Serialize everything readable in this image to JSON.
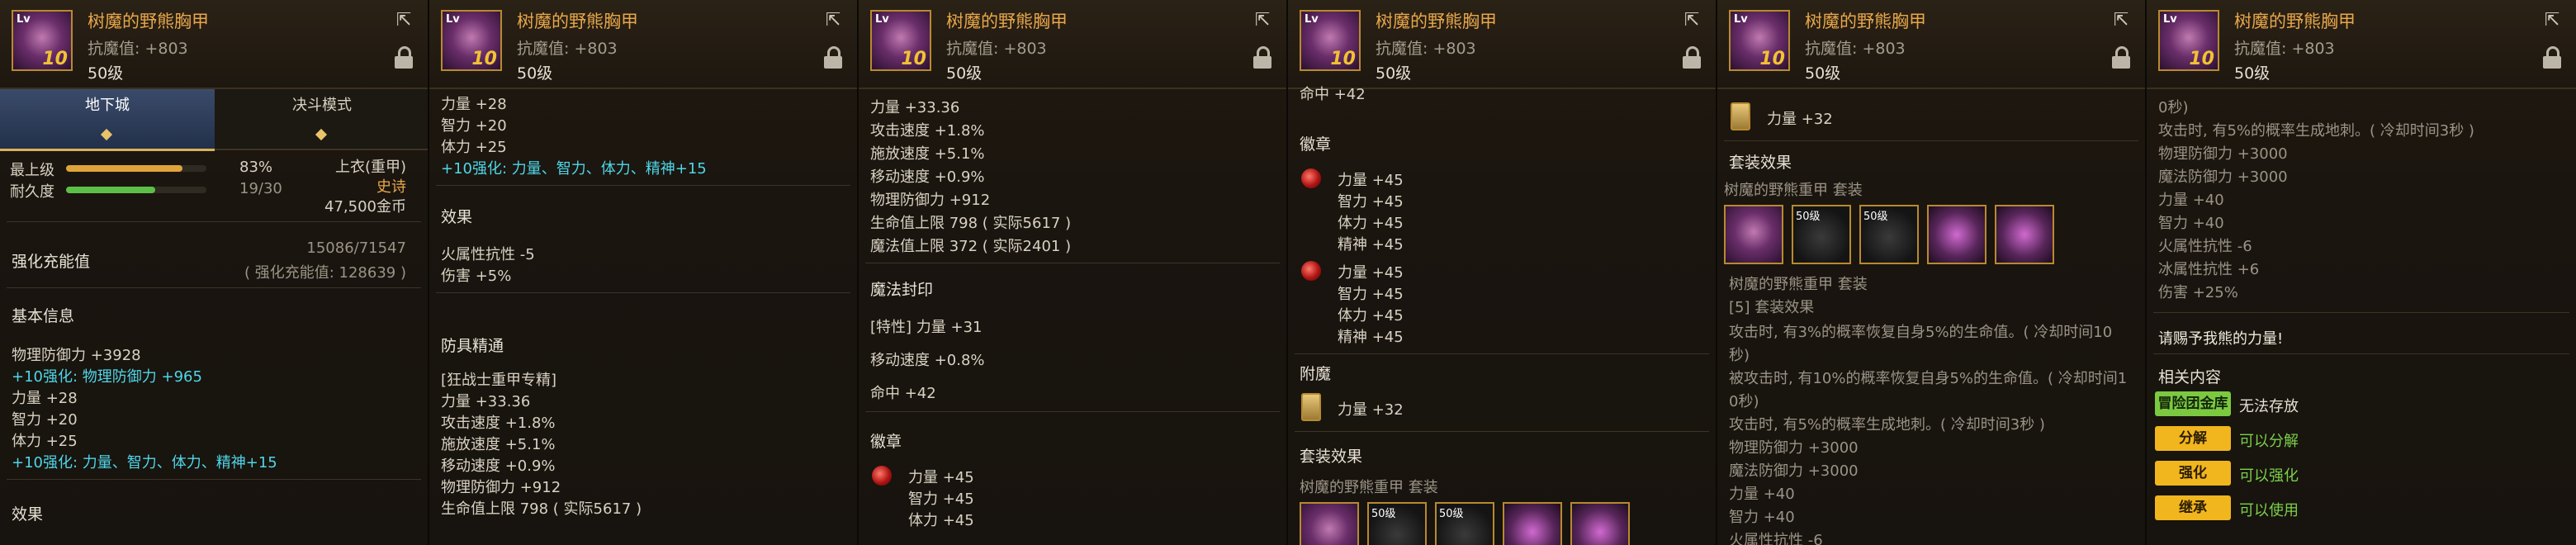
{
  "header": {
    "title": "树魔的野熊胸甲",
    "resist": "抗魔值: +803",
    "level": "50级",
    "icon_tier": "10",
    "icon_level": "Lv"
  },
  "p1": {
    "tabs": [
      "地下城",
      "决斗模式"
    ],
    "top_level_label": "最上级",
    "top_level_pct": "83%",
    "durability_label": "耐久度",
    "durability": "19/30",
    "top_level_fill": 0.83,
    "durability_fill": 0.633,
    "slot": "上衣(重甲)",
    "rarity": "史诗",
    "price": "47,500金币",
    "enh_label": "强化充能值",
    "enh_value": "15086/71547",
    "enh_sub": "( 强化充能值: 128639 )",
    "basic_title": "基本信息",
    "lines": [
      "物理防御力 +3928",
      "+10强化: 物理防御力 +965",
      "力量 +28",
      "智力 +20",
      "体力 +25",
      "+10强化: 力量、智力、体力、精神+15"
    ],
    "effect_title": "效果"
  },
  "p2": {
    "lines": [
      "力量 +28",
      "智力 +20",
      "体力 +25",
      "+10强化: 力量、智力、体力、精神+15"
    ],
    "effect_title": "效果",
    "effect_lines": [
      "火属性抗性 -5",
      "伤害 +5%"
    ],
    "mastery_title": "防具精通",
    "mastery_lines": [
      "[狂战士重甲专精]",
      "力量 +33.36",
      "攻击速度 +1.8%",
      "施放速度 +5.1%",
      "移动速度 +0.9%",
      "物理防御力 +912",
      "生命值上限 798 ( 实际5617 )"
    ]
  },
  "p3": {
    "lines": [
      "力量 +33.36",
      "攻击速度 +1.8%",
      "施放速度 +5.1%",
      "移动速度 +0.9%",
      "物理防御力 +912",
      "生命值上限 798 ( 实际5617 )",
      "魔法值上限 372 ( 实际2401 )"
    ],
    "seal_title": "魔法封印",
    "seal_lines": [
      "[特性] 力量 +31",
      "移动速度 +0.8%",
      "命中 +42"
    ],
    "emblem_title": "徽章",
    "emblem_lines": [
      "力量 +45",
      "智力 +45",
      "体力 +45"
    ]
  },
  "p4": {
    "top_line": "命中 +42",
    "emblem_title": "徽章",
    "emblem1": [
      "力量 +45",
      "智力 +45",
      "体力 +45",
      "精神 +45"
    ],
    "emblem2": [
      "力量 +45",
      "智力 +45",
      "体力 +45",
      "精神 +45"
    ],
    "enchant_title": "附魔",
    "enchant_line": "力量 +32",
    "set_title": "套装效果",
    "set_name": "树魔的野熊重甲  套装",
    "set_icons": [
      "",
      "50级",
      "50级",
      "",
      ""
    ]
  },
  "p5": {
    "enchant_line": "力量 +32",
    "set_title": "套装效果",
    "set_name": "树魔的野熊重甲  套装",
    "set_icons": [
      "",
      "50级",
      "50级",
      "",
      ""
    ],
    "set_name2": "树魔的野熊重甲  套装",
    "set_count": "[5] 套装效果",
    "lines": [
      "攻击时, 有3%的概率恢复自身5%的生命值。( 冷却时间10",
      "秒)",
      "被攻击时, 有10%的概率恢复自身5%的生命值。( 冷却时间1",
      "0秒)",
      "攻击时, 有5%的概率生成地刺。( 冷却时间3秒 )",
      "物理防御力 +3000",
      "魔法防御力 +3000",
      "力量 +40",
      "智力 +40",
      "火属性抗性 -6"
    ]
  },
  "p6": {
    "lines": [
      "0秒)",
      "攻击时, 有5%的概率生成地刺。( 冷却时间3秒 )",
      "物理防御力 +3000",
      "魔法防御力 +3000",
      "力量 +40",
      "智力 +40",
      "火属性抗性 -6",
      "冰属性抗性 +6",
      "伤害 +25%"
    ],
    "quote": "请赐予我熊的力量!",
    "related_title": "相关内容",
    "buttons": [
      {
        "label": "冒险团金库",
        "status": "无法存放"
      },
      {
        "label": "分解",
        "status": "可以分解"
      },
      {
        "label": "强化",
        "status": "可以强化"
      },
      {
        "label": "继承",
        "status": "可以使用"
      }
    ]
  },
  "colors": {
    "title": "#e8a74a",
    "cyan": "#4fd6e8",
    "green_btn": "#7bc940",
    "yellow_btn": "#f1b51e",
    "epic": "#e8a74a"
  }
}
